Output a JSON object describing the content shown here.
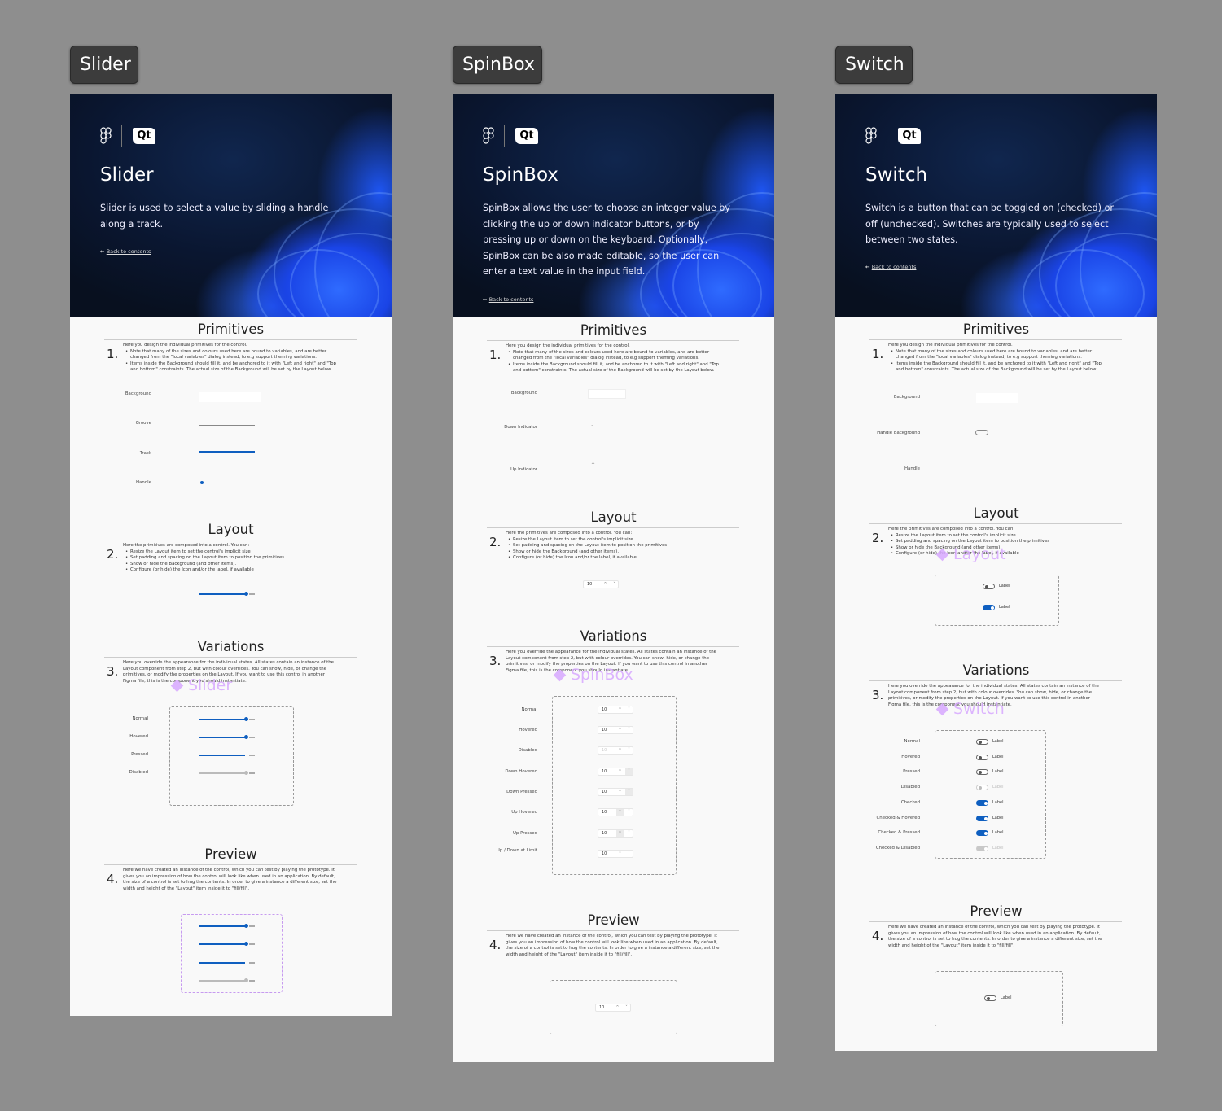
{
  "colors": {
    "accent": "#0f5fc0",
    "canvas": "#8e8e8e",
    "watermark": "#d8a8ff"
  },
  "steps": {
    "primitives": {
      "title": "Primitives",
      "number": "1.",
      "intro": "Here you design the individual primitives for the control.",
      "bullets": [
        "Note that many of the sizes and colours used here are bound to variables, and are better changed from the \"local variables\" dialog instead, to e.g support theming variations.",
        "Items inside the Background should fill it, and be anchored to it with \"Left and right\" and \"Top and bottom\" constraints. The actual size of the Background will be set by the Layout below."
      ]
    },
    "layout": {
      "title": "Layout",
      "number": "2.",
      "intro": "Here the primitives are composed into a control. You can:",
      "bullets": [
        "Resize the Layout item to set the control's implicit size",
        "Set padding and spacing on the Layout item to position the primitives",
        "Show or hide the Background (and other items).",
        "Configure (or hide) the Icon and/or the label, if available"
      ]
    },
    "variations": {
      "title": "Variations",
      "number": "3.",
      "intro": "Here you override the appearance for the individual states. All states contain an instance of the Layout component from step 2, but with colour overrides. You can show, hide, or change the primitives, or modify the properties on the Layout. If you want to use this control in another Figma file, this is the component you should instantiate."
    },
    "preview": {
      "title": "Preview",
      "number": "4.",
      "intro": "Here we have created an instance of the control, which you can test by playing the prototype. It gives you an impression of how the control will look like when used in an application.  By default, the size of a control is set to hug the contents. In order to give a instance a different size, set  the width and height of the \"Layout\" item inside it to \"fill/fill\"."
    }
  },
  "back_link": "Back to contents",
  "logo_qt": "Qt",
  "panels": [
    {
      "tab": "Slider",
      "title": "Slider",
      "description": "Slider is used to select a value by sliding a handle along a track.",
      "primitives": [
        "Background",
        "Groove",
        "Track",
        "Handle"
      ],
      "variations": [
        "Normal",
        "Hovered",
        "Pressed",
        "Disabled"
      ],
      "slider_value": 0.85,
      "watermark": "Slider"
    },
    {
      "tab": "SpinBox",
      "title": "SpinBox",
      "description": "SpinBox allows the user to choose an integer value by clicking the up or down indicator buttons, or by pressing up or down on the keyboard. Optionally, SpinBox can be also made editable, so the user can enter a text value in the input field.",
      "primitives": [
        "Background",
        "Down Indicator",
        "Up Indicator"
      ],
      "variations": [
        "Normal",
        "Hovered",
        "Disabled",
        "Down Hovered",
        "Down Pressed",
        "Up Hovered",
        "Up Pressed",
        "Up / Down at Limit"
      ],
      "value": "10",
      "up_glyph": "^",
      "down_glyph": "˅",
      "watermark": "SpinBox"
    },
    {
      "tab": "Switch",
      "title": "Switch",
      "description": "Switch is a button that can be toggled on (checked) or off (unchecked). Switches are typically used to select between two states.",
      "primitives": [
        "Background",
        "Handle Background",
        "Handle"
      ],
      "variations": [
        "Normal",
        "Hovered",
        "Pressed",
        "Disabled",
        "Checked",
        "Checked & Hovered",
        "Checked & Pressed",
        "Checked & Disabled"
      ],
      "switch_label": "Label",
      "watermark": "Switch",
      "layout_watermark": "Layout"
    }
  ]
}
